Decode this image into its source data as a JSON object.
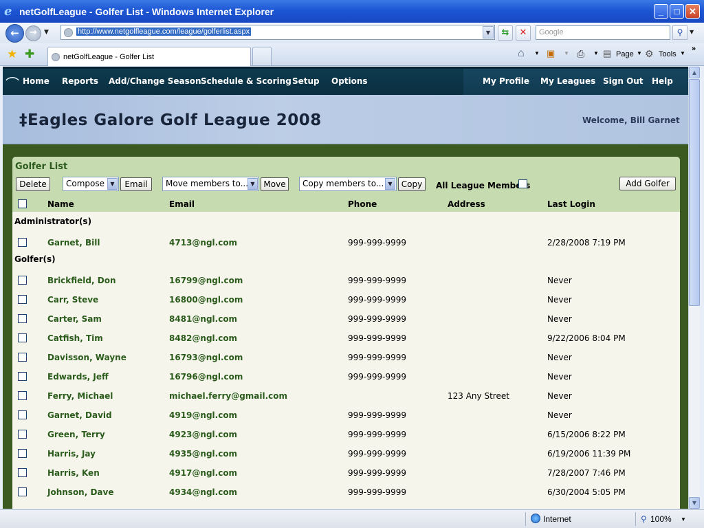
{
  "window": {
    "title": "netGolfLeague - Golfer List - Windows Internet Explorer",
    "minimize": "_",
    "maximize": "□",
    "close": "✕"
  },
  "browser": {
    "url": "http://www.netgolfleague.com/league/golferlist.aspx",
    "search_placeholder": "Google",
    "tab_title": "netGolfLeague - Golfer List",
    "cmd_page": "Page",
    "cmd_tools": "Tools",
    "status_zone": "Internet",
    "zoom": "100%"
  },
  "site_nav": {
    "left": [
      "Home",
      "Reports",
      "Add/Change Season",
      "Schedule & Scoring",
      "Setup",
      "Options"
    ],
    "right": [
      "My Profile",
      "My Leagues",
      "Sign Out",
      "Help"
    ]
  },
  "banner": {
    "league_name": "‡Eagles Galore Golf League 2008",
    "welcome": "Welcome, Bill Garnet"
  },
  "panel": {
    "title": "Golfer List",
    "delete_label": "Delete",
    "compose_value": "Compose",
    "email_label": "Email",
    "move_value": "Move members to...",
    "move_label": "Move",
    "copy_value": "Copy members to...",
    "copy_label": "Copy",
    "all_members_label": "All League Members",
    "add_golfer_label": "Add Golfer",
    "columns": [
      "Name",
      "Email",
      "Phone",
      "Address",
      "Last Login"
    ]
  },
  "groups": [
    {
      "label": "Administrator(s)",
      "rows": [
        {
          "name": "Garnet, Bill",
          "email": "4713@ngl.com",
          "phone": "999-999-9999",
          "address": "",
          "last_login": "2/28/2008 7:19 PM"
        }
      ]
    },
    {
      "label": "Golfer(s)",
      "rows": [
        {
          "name": "Brickfield, Don",
          "email": "16799@ngl.com",
          "phone": "999-999-9999",
          "address": "",
          "last_login": "Never"
        },
        {
          "name": "Carr, Steve",
          "email": "16800@ngl.com",
          "phone": "999-999-9999",
          "address": "",
          "last_login": "Never"
        },
        {
          "name": "Carter, Sam",
          "email": "8481@ngl.com",
          "phone": "999-999-9999",
          "address": "",
          "last_login": "Never"
        },
        {
          "name": "Catfish, Tim",
          "email": "8482@ngl.com",
          "phone": "999-999-9999",
          "address": "",
          "last_login": "9/22/2006 8:04 PM"
        },
        {
          "name": "Davisson, Wayne",
          "email": "16793@ngl.com",
          "phone": "999-999-9999",
          "address": "",
          "last_login": "Never"
        },
        {
          "name": "Edwards, Jeff",
          "email": "16796@ngl.com",
          "phone": "999-999-9999",
          "address": "",
          "last_login": "Never"
        },
        {
          "name": "Ferry, Michael",
          "email": "michael.ferry@gmail.com",
          "phone": "",
          "address": "123 Any Street",
          "last_login": "Never"
        },
        {
          "name": "Garnet, David",
          "email": "4919@ngl.com",
          "phone": "999-999-9999",
          "address": "",
          "last_login": "Never"
        },
        {
          "name": "Green, Terry",
          "email": "4923@ngl.com",
          "phone": "999-999-9999",
          "address": "",
          "last_login": "6/15/2006 8:22 PM"
        },
        {
          "name": "Harris, Jay",
          "email": "4935@ngl.com",
          "phone": "999-999-9999",
          "address": "",
          "last_login": "6/19/2006 11:39 PM"
        },
        {
          "name": "Harris, Ken",
          "email": "4917@ngl.com",
          "phone": "999-999-9999",
          "address": "",
          "last_login": "7/28/2007 7:46 PM"
        },
        {
          "name": "Johnson, Dave",
          "email": "4934@ngl.com",
          "phone": "999-999-9999",
          "address": "",
          "last_login": "6/30/2004 5:05 PM"
        }
      ]
    }
  ],
  "colors": {
    "nav_bg": "#0e3a4e",
    "page_bg": "#3b5a21",
    "panel_header": "#c6dbb0",
    "link_green": "#2b5c1c"
  }
}
